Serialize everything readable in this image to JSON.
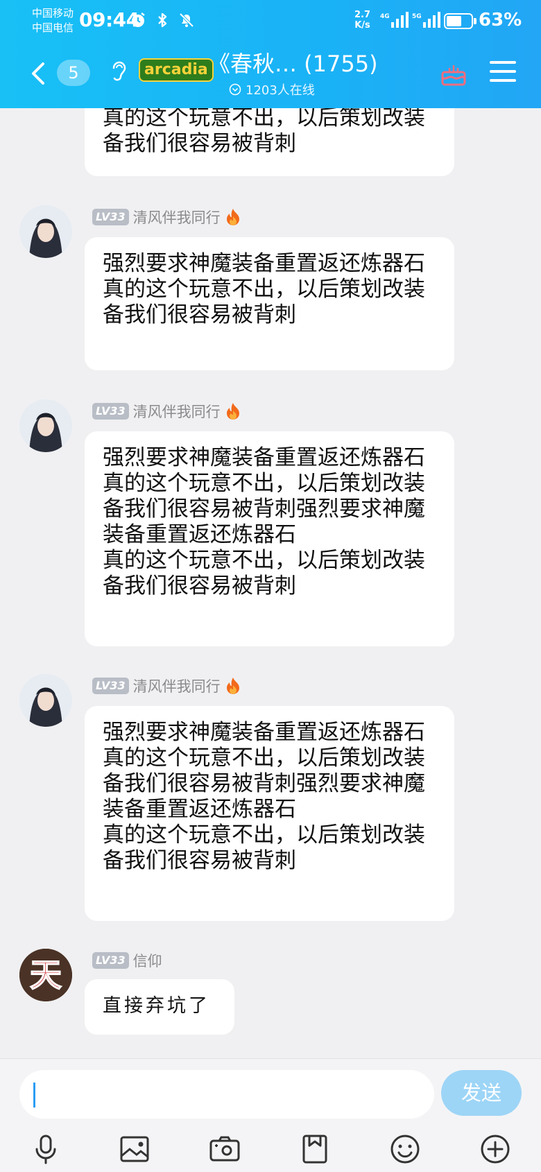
{
  "status_bar": {
    "carrier_1": "中国移动",
    "carrier_2": "中国电信",
    "time": "09:44",
    "speed_value": "2.7",
    "speed_unit": "K/s",
    "net_1": "4G",
    "net_2": "5G",
    "battery_percent": "63%",
    "battery_level": 0.63
  },
  "header": {
    "badge_count": "5",
    "logo_text": "arcadia",
    "group_title": "《春秋…  (1755)",
    "online_text": "1203人在线"
  },
  "messages": [
    {
      "text": "真的这个玩意不出，以后策划改装备我们很容易被背刺"
    },
    {
      "level": "LV33",
      "sender": "清风伴我同行",
      "text": "强烈要求神魔装备重置返还炼器石\n真的这个玩意不出，以后策划改装备我们很容易被背刺"
    },
    {
      "level": "LV33",
      "sender": "清风伴我同行",
      "text": "强烈要求神魔装备重置返还炼器石\n真的这个玩意不出，以后策划改装备我们很容易被背刺强烈要求神魔装备重置返还炼器石\n真的这个玩意不出，以后策划改装备我们很容易被背刺"
    },
    {
      "level": "LV33",
      "sender": "清风伴我同行",
      "text": "强烈要求神魔装备重置返还炼器石\n真的这个玩意不出，以后策划改装备我们很容易被背刺强烈要求神魔装备重置返还炼器石\n真的这个玩意不出，以后策划改装备我们很容易被背刺"
    },
    {
      "level": "LV33",
      "sender": "信仰",
      "avatar_glyph": "天",
      "text": "直接弃坑了"
    }
  ],
  "input": {
    "send_label": "发送"
  },
  "toolbar_icons": [
    "microphone-icon",
    "image-icon",
    "camera-icon",
    "file-icon",
    "emoji-icon",
    "plus-icon"
  ],
  "colors": {
    "header_bg": "#1ab2f6",
    "send_bg": "#9dd5f7",
    "level_badge": "#b8bdc6",
    "cake_icon": "#f26d7d"
  }
}
